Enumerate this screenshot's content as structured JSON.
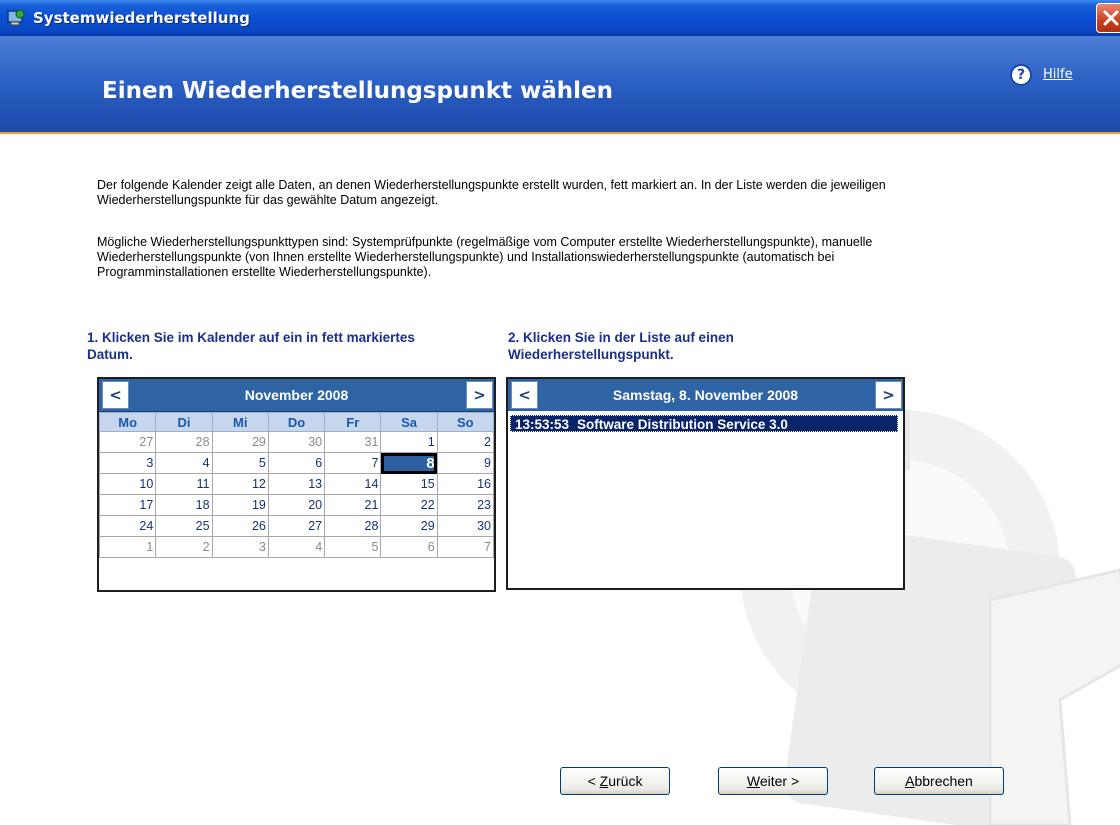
{
  "window": {
    "title": "Systemwiederherstellung"
  },
  "header": {
    "title": "Einen Wiederherstellungspunkt wählen",
    "help_label": "Hilfe"
  },
  "intro": {
    "para1": "Der folgende Kalender zeigt alle Daten, an denen Wiederherstellungspunkte erstellt wurden, fett markiert an. In der Liste werden die jeweiligen Wiederherstellungspunkte für das gewählte Datum angezeigt.",
    "para2": "Mögliche Wiederherstellungspunkttypen sind: Systemprüfpunkte (regelmäßige vom Computer erstellte Wiederherstellungspunkte), manuelle Wiederherstellungspunkte (von Ihnen erstellte Wiederherstellungspunkte) und Installationswiederherstellungspunkte (automatisch bei Programminstallationen erstellte Wiederherstellungspunkte)."
  },
  "step1": {
    "label": "1. Klicken Sie im Kalender auf ein in fett markiertes Datum."
  },
  "step2": {
    "label": "2. Klicken Sie in der Liste auf einen Wiederherstellungspunkt."
  },
  "calendar": {
    "month_label": "November 2008",
    "prev_label": "<",
    "next_label": ">",
    "weekdays": [
      "Mo",
      "Di",
      "Mi",
      "Do",
      "Fr",
      "Sa",
      "So"
    ],
    "weeks": [
      [
        {
          "d": "27",
          "other": true
        },
        {
          "d": "28",
          "other": true
        },
        {
          "d": "29",
          "other": true
        },
        {
          "d": "30",
          "other": true
        },
        {
          "d": "31",
          "other": true
        },
        {
          "d": "1"
        },
        {
          "d": "2"
        }
      ],
      [
        {
          "d": "3"
        },
        {
          "d": "4"
        },
        {
          "d": "5"
        },
        {
          "d": "6"
        },
        {
          "d": "7"
        },
        {
          "d": "8",
          "selected": true
        },
        {
          "d": "9"
        }
      ],
      [
        {
          "d": "10"
        },
        {
          "d": "11"
        },
        {
          "d": "12"
        },
        {
          "d": "13"
        },
        {
          "d": "14"
        },
        {
          "d": "15"
        },
        {
          "d": "16"
        }
      ],
      [
        {
          "d": "17"
        },
        {
          "d": "18"
        },
        {
          "d": "19"
        },
        {
          "d": "20"
        },
        {
          "d": "21"
        },
        {
          "d": "22"
        },
        {
          "d": "23"
        }
      ],
      [
        {
          "d": "24"
        },
        {
          "d": "25"
        },
        {
          "d": "26"
        },
        {
          "d": "27"
        },
        {
          "d": "28"
        },
        {
          "d": "29"
        },
        {
          "d": "30"
        }
      ],
      [
        {
          "d": "1",
          "other": true
        },
        {
          "d": "2",
          "other": true
        },
        {
          "d": "3",
          "other": true
        },
        {
          "d": "4",
          "other": true
        },
        {
          "d": "5",
          "other": true
        },
        {
          "d": "6",
          "other": true
        },
        {
          "d": "7",
          "other": true
        }
      ]
    ]
  },
  "restore_list": {
    "date_label": "Samstag, 8. November 2008",
    "prev_label": "<",
    "next_label": ">",
    "items": [
      {
        "time": "13:53:53",
        "name": "Software Distribution Service 3.0",
        "selected": true
      }
    ]
  },
  "buttons": {
    "back": {
      "prefix": "< ",
      "key": "Z",
      "rest": "urück"
    },
    "next": {
      "key": "W",
      "rest": "eiter >"
    },
    "cancel": {
      "key": "A",
      "rest": "bbrechen"
    }
  },
  "colors": {
    "banner": "#2a5fc4",
    "accent": "#f29c34",
    "selection": "#0a246a"
  },
  "icons": {
    "app": "system-restore-icon",
    "help": "help-question-icon",
    "close": "close-icon"
  }
}
